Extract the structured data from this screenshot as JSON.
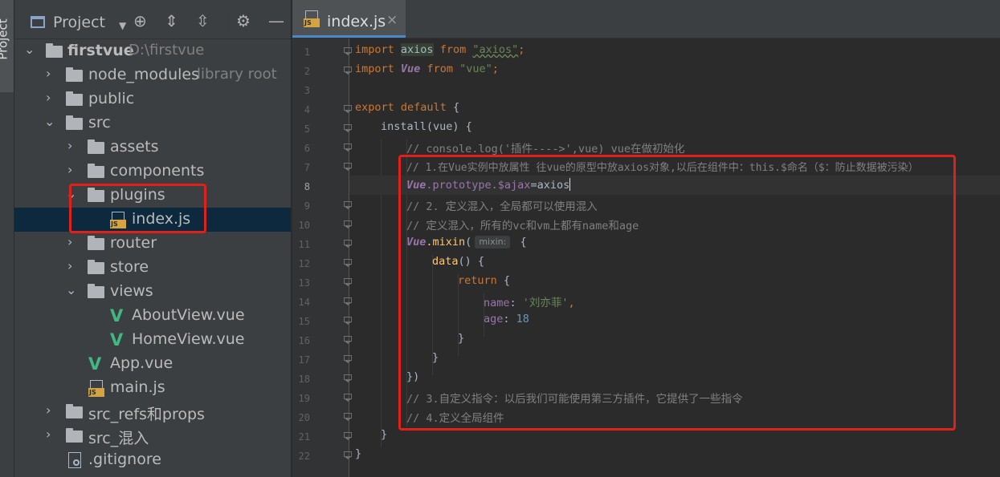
{
  "side_strip": {
    "label": "Project"
  },
  "project_panel": {
    "title": "Project",
    "tree": [
      {
        "label": "firstvue",
        "hint": "D:\\firstvue",
        "type": "folder",
        "bold": true
      },
      {
        "label": "node_modules",
        "hint": "library root",
        "type": "folder"
      },
      {
        "label": "public",
        "type": "folder"
      },
      {
        "label": "src",
        "type": "folder"
      },
      {
        "label": "assets",
        "type": "folder"
      },
      {
        "label": "components",
        "type": "folder"
      },
      {
        "label": "plugins",
        "type": "folder"
      },
      {
        "label": "index.js",
        "type": "js",
        "selected": true
      },
      {
        "label": "router",
        "type": "folder"
      },
      {
        "label": "store",
        "type": "folder"
      },
      {
        "label": "views",
        "type": "folder"
      },
      {
        "label": "AboutView.vue",
        "type": "vue"
      },
      {
        "label": "HomeView.vue",
        "type": "vue"
      },
      {
        "label": "App.vue",
        "type": "vue"
      },
      {
        "label": "main.js",
        "type": "js"
      },
      {
        "label": "src_refs和props",
        "type": "folder"
      },
      {
        "label": "src_混入",
        "type": "folder"
      },
      {
        "label": ".gitignore",
        "type": "git"
      }
    ]
  },
  "editor": {
    "tab": {
      "label": "index.js",
      "close": "×"
    },
    "line_numbers": [
      "1",
      "2",
      "3",
      "4",
      "5",
      "6",
      "7",
      "8",
      "9",
      "10",
      "11",
      "12",
      "13",
      "14",
      "15",
      "16",
      "17",
      "18",
      "19",
      "20",
      "21",
      "22"
    ],
    "current_line": 8,
    "code": {
      "l1": {
        "kw1": "import",
        "id": "axios",
        "kw2": "from",
        "str": "\"axios\"",
        "end": ";"
      },
      "l2": {
        "kw1": "import",
        "id": "Vue",
        "kw2": "from",
        "str": "\"vue\"",
        "end": ";"
      },
      "l4": {
        "kw1": "export",
        "kw2": "default",
        "end": " {"
      },
      "l5": {
        "fn": "install",
        "rest": "(vue) {"
      },
      "l6": {
        "comment": "// console.log('插件---->',vue) vue在做初始化"
      },
      "l7": {
        "comment": "// 1.在Vue实例中放属性 往vue的原型中放axios对象,以后在组件中：this.$命名（$：防止数据被污染）"
      },
      "l8": {
        "vue": "Vue",
        "p1": ".prototype.",
        "prop": "$ajax",
        "eq": "=axios"
      },
      "l9": {
        "comment": "// 2. 定义混入，全局都可以使用混入"
      },
      "l10": {
        "comment": "// 定义混入，所有的vc和vm上都有name和age"
      },
      "l11": {
        "vue": "Vue",
        "fn": ".mixin",
        "open": "(",
        "hint": "mixin:",
        "rest": " {"
      },
      "l12": {
        "fn": "data",
        "rest": "() {"
      },
      "l13": {
        "kw": "return",
        "rest": " {"
      },
      "l14": {
        "prop": "name",
        "colon": ": ",
        "str": "'刘亦菲'",
        "end": ","
      },
      "l15": {
        "prop": "age",
        "colon": ": ",
        "num": "18"
      },
      "l16": {
        "text": "}"
      },
      "l17": {
        "text": "}"
      },
      "l18": {
        "text": "})"
      },
      "l19": {
        "comment": "// 3.自定义指令：以后我们可能使用第三方插件，它提供了一些指令"
      },
      "l20": {
        "comment": "// 4.定义全局组件"
      },
      "l21": {
        "text": "}"
      },
      "l22": {
        "text": "}"
      }
    }
  },
  "colors": {
    "annotation_box": "#e0211a",
    "selection": "#0d293e",
    "keyword": "#cc7832",
    "string": "#6a8759",
    "comment": "#808080"
  }
}
